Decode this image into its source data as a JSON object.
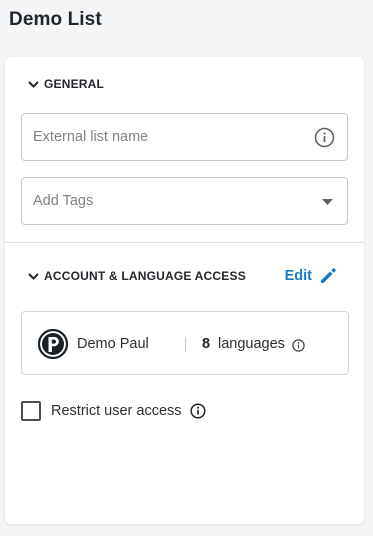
{
  "page": {
    "title": "Demo List"
  },
  "general": {
    "section_label": "GENERAL",
    "external_list_name": {
      "value": "",
      "placeholder": "External list name"
    },
    "tags": {
      "value": "",
      "placeholder": "Add Tags"
    }
  },
  "access": {
    "section_label": "ACCOUNT & LANGUAGE ACCESS",
    "edit_label": "Edit",
    "account": {
      "name": "Demo Paul",
      "language_count": "8",
      "language_label": "languages"
    },
    "restrict": {
      "label": "Restrict user access",
      "checked": false
    }
  },
  "colors": {
    "accent": "#1b7ac4",
    "text": "#2b2f33",
    "border": "#c5c9ce",
    "background": "#f4f5f7"
  },
  "icons": {
    "section_toggle": "chevron-down-icon",
    "name_info": "info-icon",
    "tags_dropdown": "caret-down-icon",
    "edit": "pencil-icon",
    "account_logo": "account-logo-icon",
    "languages_info": "info-icon",
    "restrict_info": "info-icon"
  }
}
